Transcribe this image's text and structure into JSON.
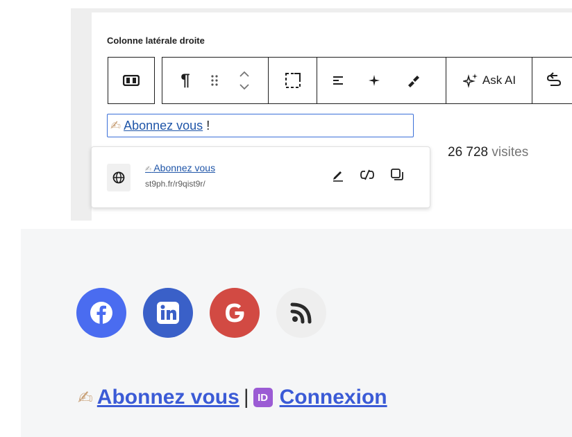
{
  "editor": {
    "sidebar_title": "Colonne latérale droite",
    "toolbar": {
      "ask_ai_label": "Ask AI"
    },
    "link_input": {
      "text": "Abonnez vous",
      "suffix": "!"
    },
    "visits": {
      "count": "26 728",
      "label": "visites"
    },
    "link_popover": {
      "title": "Abonnez vous",
      "url": "st9ph.fr/r9qist9r/"
    }
  },
  "footer": {
    "social_icons": [
      "facebook-icon",
      "linkedin-icon",
      "google-icon",
      "rss-icon"
    ],
    "links": {
      "subscribe": "Abonnez vous",
      "separator": "|",
      "id_badge": "ID",
      "login": "Connexion"
    }
  },
  "colors": {
    "facebook": "#4a6cf0",
    "linkedin": "#3a60c8",
    "google": "#d24a43",
    "rss_bg": "#eeeeee",
    "link": "#3b5bd6",
    "id_badge": "#9b5bd4"
  }
}
